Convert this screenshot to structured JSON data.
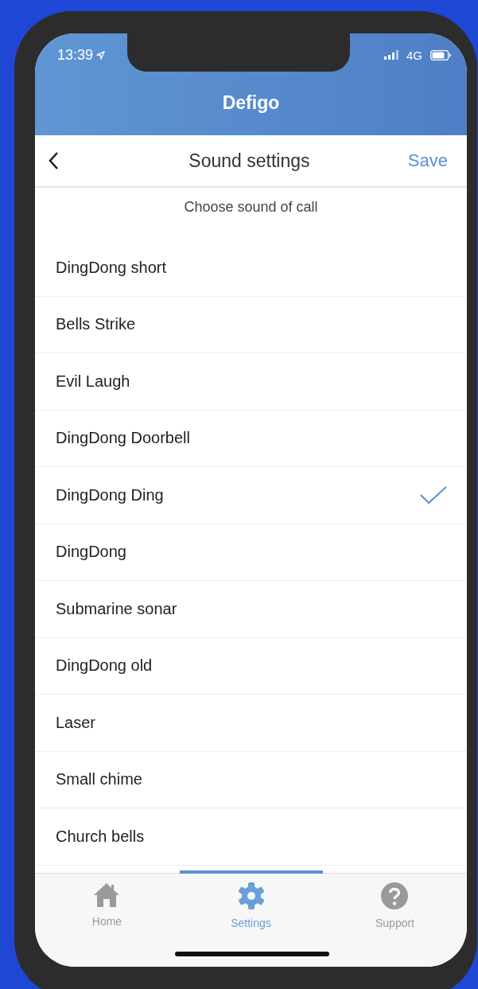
{
  "status_bar": {
    "time": "13:39",
    "network": "4G"
  },
  "app_header": {
    "title": "Defigo"
  },
  "nav_bar": {
    "title": "Sound settings",
    "action": "Save"
  },
  "subtitle": "Choose sound of call",
  "sounds": [
    {
      "label": "DingDong short",
      "selected": false
    },
    {
      "label": "Bells Strike",
      "selected": false
    },
    {
      "label": "Evil Laugh",
      "selected": false
    },
    {
      "label": "DingDong Doorbell",
      "selected": false
    },
    {
      "label": "DingDong Ding",
      "selected": true
    },
    {
      "label": "DingDong",
      "selected": false
    },
    {
      "label": "Submarine sonar",
      "selected": false
    },
    {
      "label": "DingDong old",
      "selected": false
    },
    {
      "label": "Laser",
      "selected": false
    },
    {
      "label": "Small chime",
      "selected": false
    },
    {
      "label": "Church bells",
      "selected": false
    }
  ],
  "tabs": [
    {
      "label": "Home",
      "kind": "home",
      "selected": false
    },
    {
      "label": "Settings",
      "kind": "settings",
      "selected": true
    },
    {
      "label": "Support",
      "kind": "support",
      "selected": false
    }
  ]
}
